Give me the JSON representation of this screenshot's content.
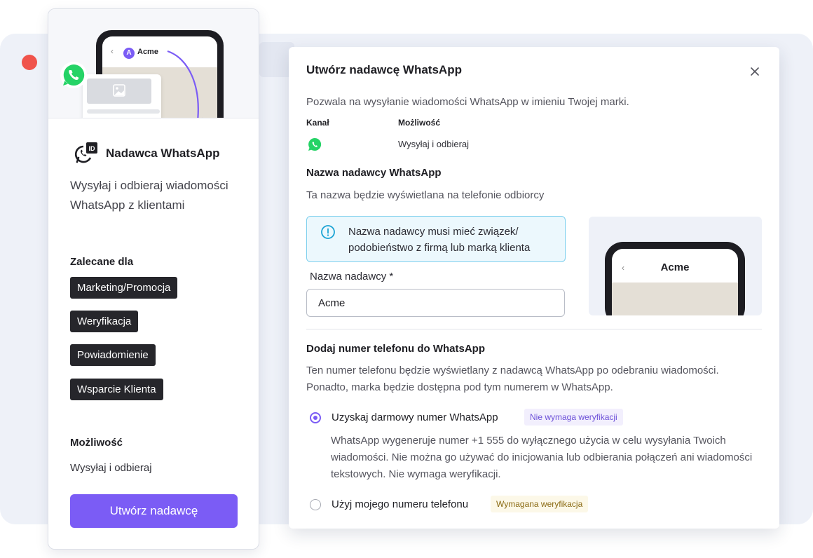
{
  "colors": {
    "accent": "#7b5cf5",
    "whatsapp_green": "#25d366",
    "tag_bg": "#26262b",
    "info_border": "#7fd0ee",
    "window_red": "#f0534b"
  },
  "left_card": {
    "hero": {
      "phone_contact": "Acme",
      "avatar_letter": "A"
    },
    "brand_icon_text": "ID",
    "title": "Nadawca WhatsApp",
    "description": "Wysyłaj i odbieraj wiadomości WhatsApp z klientami",
    "recommended_heading": "Zalecane dla",
    "tags": [
      "Marketing/Promocja",
      "Weryfikacja",
      "Powiadomienie",
      "Wsparcie Klienta"
    ],
    "capability_heading": "Możliwość",
    "capability_value": "Wysyłaj i odbieraj",
    "create_button": "Utwórz nadawcę"
  },
  "modal": {
    "title": "Utwórz nadawcę WhatsApp",
    "close_icon": "close-icon",
    "intro": "Pozwala na wysyłanie wiadomości WhatsApp w imieniu Twojej marki.",
    "table": {
      "channel_header": "Kanał",
      "capability_header": "Możliwość",
      "channel_icon": "whatsapp-icon",
      "capability_value": "Wysyłaj i odbieraj"
    },
    "sender_section": {
      "heading": "Nazwa nadawcy WhatsApp",
      "subtext": "Ta nazwa będzie wyświetlana na telefonie odbiorcy",
      "info": "Nazwa nadawcy musi mieć związek/ podobieństwo z firmą lub marką klienta",
      "field_label": "Nazwa nadawcy *",
      "field_value": "Acme",
      "preview_title": "Acme"
    },
    "phone_section": {
      "heading": "Dodaj numer telefonu do WhatsApp",
      "description": "Ten numer telefonu będzie wyświetlany z nadawcą WhatsApp po odebraniu wiadomości. Ponadto, marka będzie dostępna pod tym numerem w WhatsApp.",
      "options": [
        {
          "label": "Uzyskaj darmowy numer WhatsApp",
          "badge": "Nie wymaga weryfikacji",
          "selected": true,
          "description": "WhatsApp wygeneruje numer +1 555 do wyłącznego użycia w celu wysyłania Twoich wiadomości. Nie można go używać do inicjowania lub odbierania połączeń ani wiadomości tekstowych. Nie wymaga weryfikacji."
        },
        {
          "label": "Użyj mojego numeru telefonu",
          "badge": "Wymagana weryfikacja",
          "selected": false
        }
      ]
    }
  }
}
